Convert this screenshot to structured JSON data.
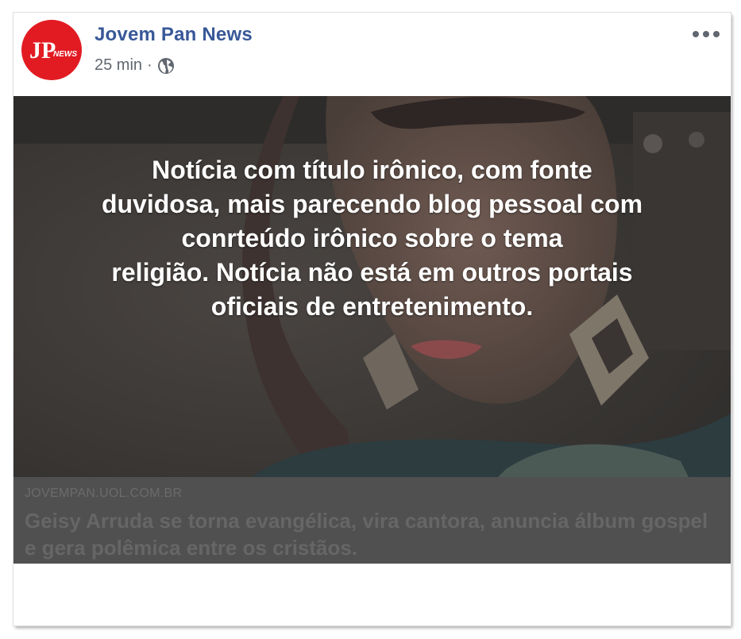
{
  "post": {
    "page_name": "Jovem Pan News",
    "timestamp": "25 min",
    "separator": "·",
    "privacy_icon": "globe-icon",
    "options_icon": "more-options-icon",
    "avatar_logo_text": "JP NEWS"
  },
  "media": {
    "overlay_lines": [
      "Notícia com título irônico, com fonte",
      "duvidosa, mais parecendo blog pessoal com",
      "conrteúdo irônico sobre o tema",
      "religião. Notícia não está em outros portais",
      "oficiais de entretenimento."
    ]
  },
  "link_preview": {
    "domain": "JOVEMPAN.UOL.COM.BR",
    "title": "Geisy Arruda se torna evangélica, vira cantora, anuncia álbum gospel e gera polêmica entre os cristãos."
  },
  "colors": {
    "brand_red": "#e21b23",
    "page_name_blue": "#385898",
    "overlay_dark": "#3b3835",
    "link_box_gray": "#505050"
  }
}
